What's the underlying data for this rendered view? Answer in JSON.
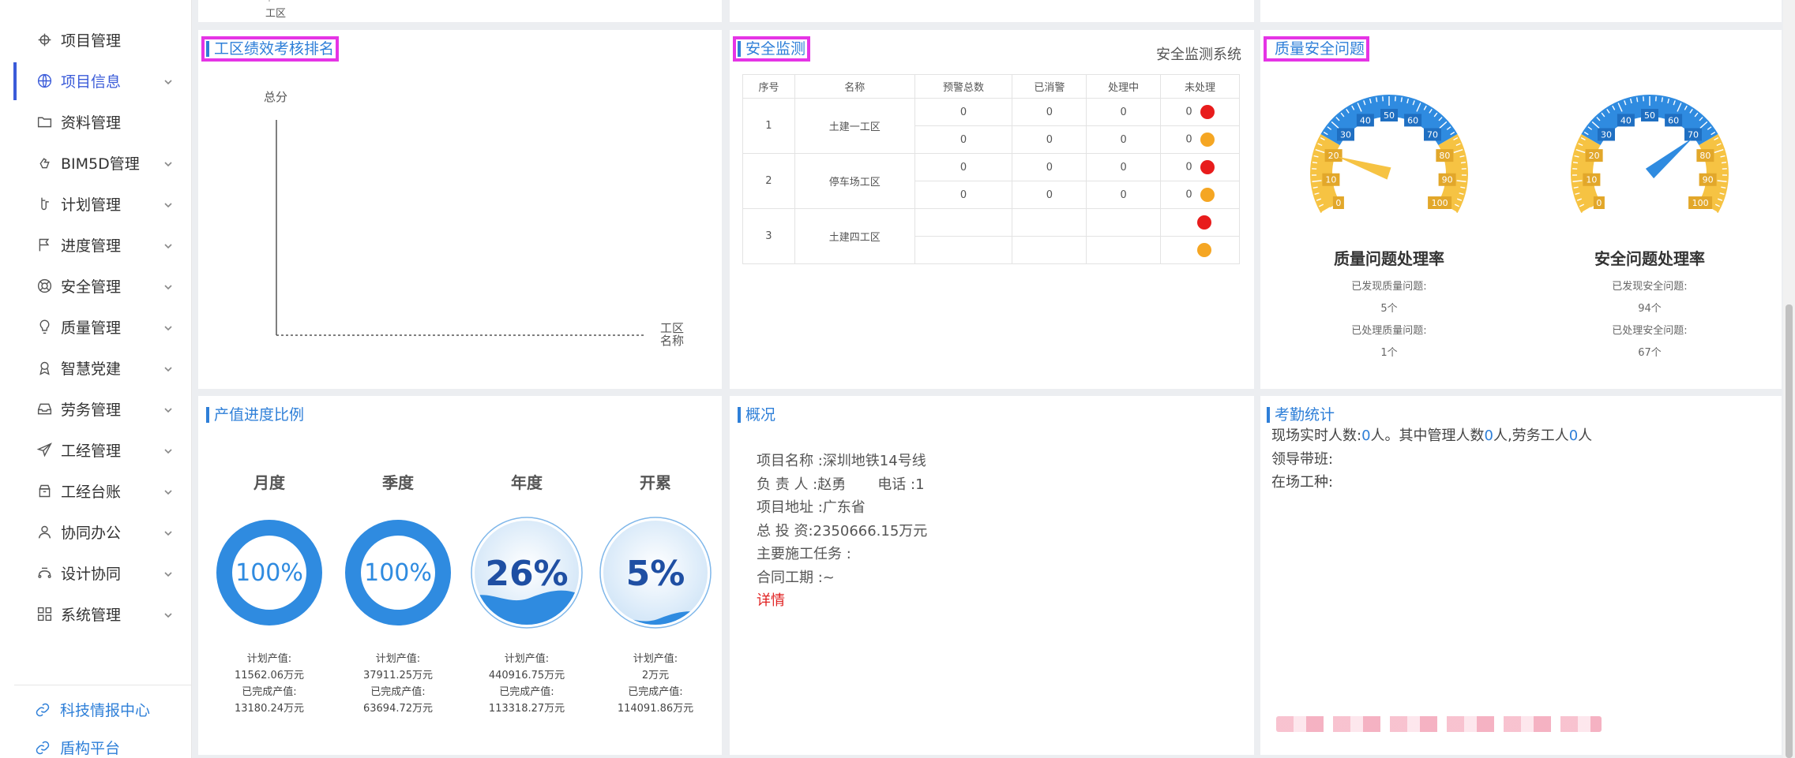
{
  "sidebar": {
    "items": [
      {
        "label": "项目管理",
        "icon": "crosshair-icon",
        "chevron": false,
        "active": false
      },
      {
        "label": "项目信息",
        "icon": "globe-icon",
        "chevron": true,
        "active": true
      },
      {
        "label": "资料管理",
        "icon": "folder-icon",
        "chevron": false,
        "active": false
      },
      {
        "label": "BIM5D管理",
        "icon": "hand-icon",
        "chevron": true,
        "active": false
      },
      {
        "label": "计划管理",
        "icon": "tag-icon",
        "chevron": true,
        "active": false
      },
      {
        "label": "进度管理",
        "icon": "flag-icon",
        "chevron": true,
        "active": false
      },
      {
        "label": "安全管理",
        "icon": "lifebuoy-icon",
        "chevron": true,
        "active": false
      },
      {
        "label": "质量管理",
        "icon": "bulb-icon",
        "chevron": true,
        "active": false
      },
      {
        "label": "智慧党建",
        "icon": "award-icon",
        "chevron": true,
        "active": false
      },
      {
        "label": "劳务管理",
        "icon": "inbox-icon",
        "chevron": true,
        "active": false
      },
      {
        "label": "工经管理",
        "icon": "send-icon",
        "chevron": true,
        "active": false
      },
      {
        "label": "工经台账",
        "icon": "box-icon",
        "chevron": true,
        "active": false
      },
      {
        "label": "协同办公",
        "icon": "user-icon",
        "chevron": true,
        "active": false
      },
      {
        "label": "设计协同",
        "icon": "gamepad-icon",
        "chevron": true,
        "active": false
      },
      {
        "label": "系统管理",
        "icon": "grid-icon",
        "chevron": true,
        "active": false
      }
    ],
    "links": [
      {
        "label": "科技情报中心",
        "icon": "link-icon"
      },
      {
        "label": "盾构平台",
        "icon": "link-icon"
      }
    ]
  },
  "top_strip": {
    "xlabel_fragment": "工区"
  },
  "performance": {
    "title": "工区绩效考核排名",
    "ylabel": "总分",
    "xlabel_line1": "工区",
    "xlabel_line2": "名称"
  },
  "safety": {
    "title": "安全监测",
    "subtitle": "安全监测系统",
    "headers": [
      "序号",
      "名称",
      "预警总数",
      "已消警",
      "处理中",
      "未处理"
    ],
    "rows": [
      {
        "no": "1",
        "name": "土建一工区",
        "lines": [
          [
            "0",
            "0",
            "0",
            "0"
          ],
          [
            "0",
            "0",
            "0",
            "0"
          ]
        ]
      },
      {
        "no": "2",
        "name": "停车场工区",
        "lines": [
          [
            "0",
            "0",
            "0",
            "0"
          ],
          [
            "0",
            "0",
            "0",
            "0"
          ]
        ]
      },
      {
        "no": "3",
        "name": "土建四工区",
        "lines": [
          [
            "",
            "",
            "",
            ""
          ],
          [
            "",
            "",
            "",
            ""
          ]
        ]
      }
    ],
    "colors": {
      "red": "#e81c1c",
      "orange": "#f5a623"
    }
  },
  "quality": {
    "title": "质量安全问题",
    "gauges": [
      {
        "name": "质量问题处理率",
        "found_label": "已发现质量问题:",
        "found": "5个",
        "handled_label": "已处理质量问题:",
        "handled": "1个",
        "value": 20
      },
      {
        "name": "安全问题处理率",
        "found_label": "已发现安全问题:",
        "found": "94个",
        "handled_label": "已处理安全问题:",
        "handled": "67个",
        "value": 71
      }
    ],
    "ticks": [
      "0",
      "10",
      "20",
      "30",
      "40",
      "50",
      "60",
      "70",
      "80",
      "90",
      "100"
    ]
  },
  "output": {
    "title": "产值进度比例",
    "items": [
      {
        "period": "月度",
        "percent": "100%",
        "value": 100,
        "style": "ring",
        "plan_label": "计划产值:",
        "plan": "11562.06万元",
        "done_label": "已完成产值:",
        "done": "13180.24万元"
      },
      {
        "period": "季度",
        "percent": "100%",
        "value": 100,
        "style": "ring",
        "plan_label": "计划产值:",
        "plan": "37911.25万元",
        "done_label": "已完成产值:",
        "done": "63694.72万元"
      },
      {
        "period": "年度",
        "percent": "26%",
        "value": 26,
        "style": "wave",
        "plan_label": "计划产值:",
        "plan": "440916.75万元",
        "done_label": "已完成产值:",
        "done": "113318.27万元"
      },
      {
        "period": "开累",
        "percent": "5%",
        "value": 5,
        "style": "wave",
        "plan_label": "计划产值:",
        "plan": "2万元",
        "done_label": "已完成产值:",
        "done": "114091.86万元"
      }
    ]
  },
  "overview": {
    "title": "概况",
    "lines": [
      "项目名称 :深圳地铁14号线",
      "负 责 人 :赵勇       电话 :1",
      "项目地址 :广东省",
      "总 投 资:2350666.15万元",
      "主要施工任务 :",
      "合同工期 :~"
    ],
    "detail_link": "详情"
  },
  "attendance": {
    "title": "考勤统计",
    "line1_a": "现场实时人数:",
    "line1_v1": "0",
    "line1_b": "人。其中管理人数",
    "line1_v2": "0",
    "line1_c": "人,劳务工人",
    "line1_v3": "0",
    "line1_d": "人",
    "line2": "领导带班:",
    "line3": "在场工种:"
  }
}
